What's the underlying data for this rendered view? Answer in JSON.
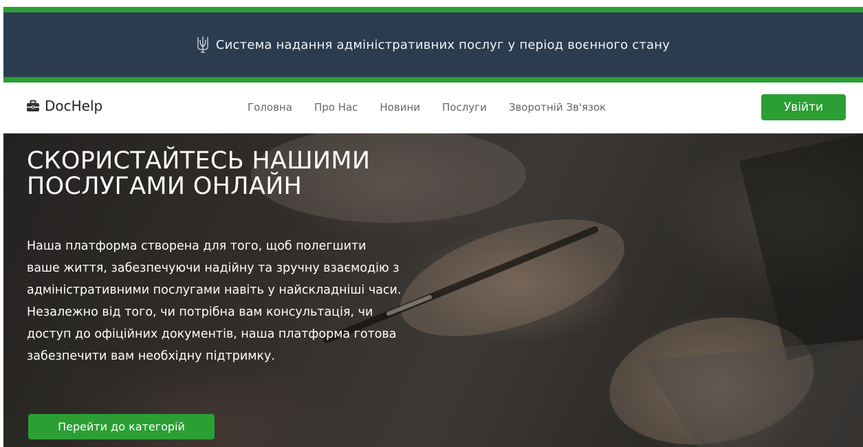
{
  "banner": {
    "text": "Система надання адміністративних послуг у період воєнного стану",
    "icon": "trident-icon"
  },
  "navbar": {
    "brand": "DocHelp",
    "brand_icon": "briefcase-icon",
    "links": [
      "Головна",
      "Про Нас",
      "Новини",
      "Послуги",
      "Зворотній Зв'язок"
    ],
    "login_label": "Увійти"
  },
  "hero": {
    "title": "СКОРИСТАЙТЕСЬ НАШИМИ ПОСЛУГАМИ ОНЛАЙН",
    "text": "Наша платформа створена для того, щоб полегшити ваше життя, забезпечуючи надійну та зручну взаємодію з адміністративними послугами навіть у найскладніші часи. Незалежно від того, чи потрібна вам консультація, чи доступ до офіційних документів, наша платформа готова забезпечити вам необхідну підтримку.",
    "cta_label": "Перейти до категорій"
  },
  "colors": {
    "accent_green": "#2b9f34",
    "banner_bg": "#2b3c50"
  }
}
